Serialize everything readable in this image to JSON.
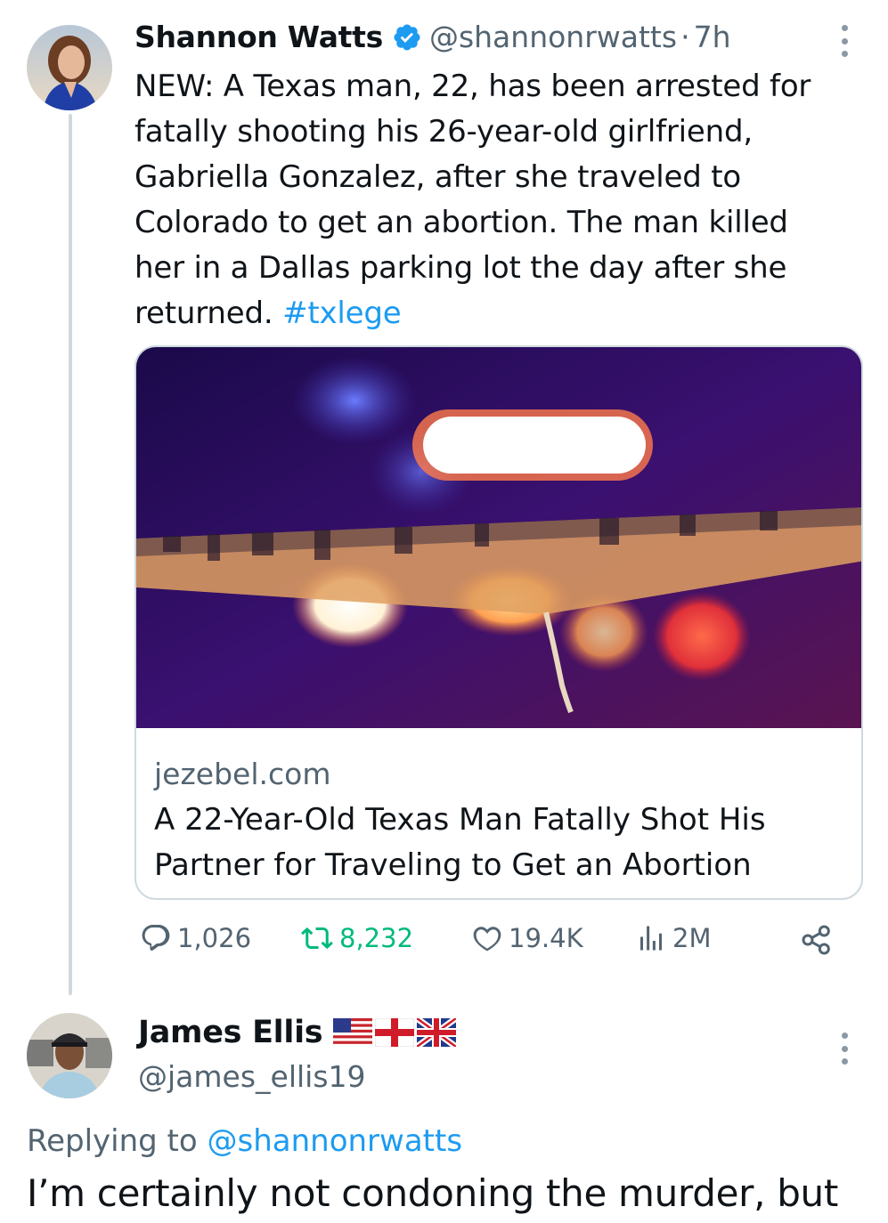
{
  "tweet": {
    "author_name": "Shannon Watts",
    "author_handle": "@shannonrwatts",
    "separator": "·",
    "timestamp": "7h",
    "verified": true,
    "text_main": "NEW: A Texas man, 22, has been arrested for fatally shooting his 26-year-old girlfriend, Gabriella Gonzalez, after she traveled to Colorado to get an abortion. The man killed her in a Dallas parking lot the day after she returned.",
    "hashtag": "#txlege",
    "link_card": {
      "domain": "jezebel.com",
      "title": "A 22-Year-Old Texas Man Fatally Shot His Partner for Traveling to Get an Abortion"
    },
    "actions": {
      "replies": "1,026",
      "retweets": "8,232",
      "likes": "19.4K",
      "views": "2M"
    }
  },
  "reply": {
    "author_name": "James Ellis",
    "flags": [
      "us-flag-icon",
      "england-flag-icon",
      "uk-flag-icon"
    ],
    "author_handle": "@james_ellis19",
    "replying_prefix": "Replying to",
    "replying_handle": "@shannonrwatts",
    "text": "I’m certainly not condoning the murder, but"
  },
  "colors": {
    "link": "#1d9bf0",
    "secondary_text": "#536471",
    "retweet_green": "#00ba7c",
    "border": "#cfd9de"
  }
}
